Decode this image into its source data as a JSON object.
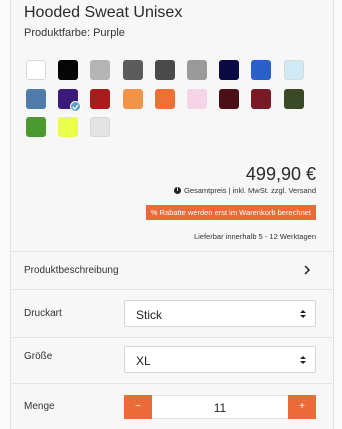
{
  "product": {
    "title": "Hooded Sweat Unisex",
    "color_label": "Produktfarbe: Purple",
    "selected_color": "Purple"
  },
  "swatches": [
    {
      "name": "white",
      "color": "#ffffff"
    },
    {
      "name": "black",
      "color": "#050505"
    },
    {
      "name": "light-heather-grey",
      "color": "#b4b4b4"
    },
    {
      "name": "dark-grey",
      "color": "#5c5c5c"
    },
    {
      "name": "charcoal",
      "color": "#4a4a4a"
    },
    {
      "name": "heather-grey",
      "color": "#9a9a9a"
    },
    {
      "name": "navy",
      "color": "#0b0a45"
    },
    {
      "name": "royal-blue",
      "color": "#2b5fc9"
    },
    {
      "name": "light-blue",
      "color": "#cfeaf7"
    },
    {
      "name": "heather-blue",
      "color": "#4f7cab"
    },
    {
      "name": "purple",
      "color": "#3b1a7c"
    },
    {
      "name": "red",
      "color": "#a81d1b"
    },
    {
      "name": "orange",
      "color": "#f19447"
    },
    {
      "name": "dark-orange",
      "color": "#ef6f35"
    },
    {
      "name": "light-pink",
      "color": "#f7d3e8"
    },
    {
      "name": "burgundy",
      "color": "#4a0f17"
    },
    {
      "name": "maroon",
      "color": "#7a1a26"
    },
    {
      "name": "olive",
      "color": "#3a4a26"
    },
    {
      "name": "green",
      "color": "#4b9a2f"
    },
    {
      "name": "neon-yellow",
      "color": "#e9ff4a"
    },
    {
      "name": "ash",
      "color": "#e3e3e3"
    }
  ],
  "pricing": {
    "price": "499,90 €",
    "note": "Gesamtpreis | inkl. MwSt. zzgl. Versand",
    "discount": "% Rabatte werden erst im Warenkorb berechnet",
    "delivery": "Lieferbar innerhalb 5 - 12 Werktagen"
  },
  "options": {
    "description_label": "Produktbeschreibung",
    "print_type_label": "Druckart",
    "print_type_value": "Stick",
    "size_label": "Größe",
    "size_value": "XL",
    "quantity_label": "Menge",
    "quantity_value": "11",
    "decrement": "−",
    "increment": "+"
  },
  "colors": {
    "accent": "#ec6a37",
    "check": "#5aa0c8"
  }
}
